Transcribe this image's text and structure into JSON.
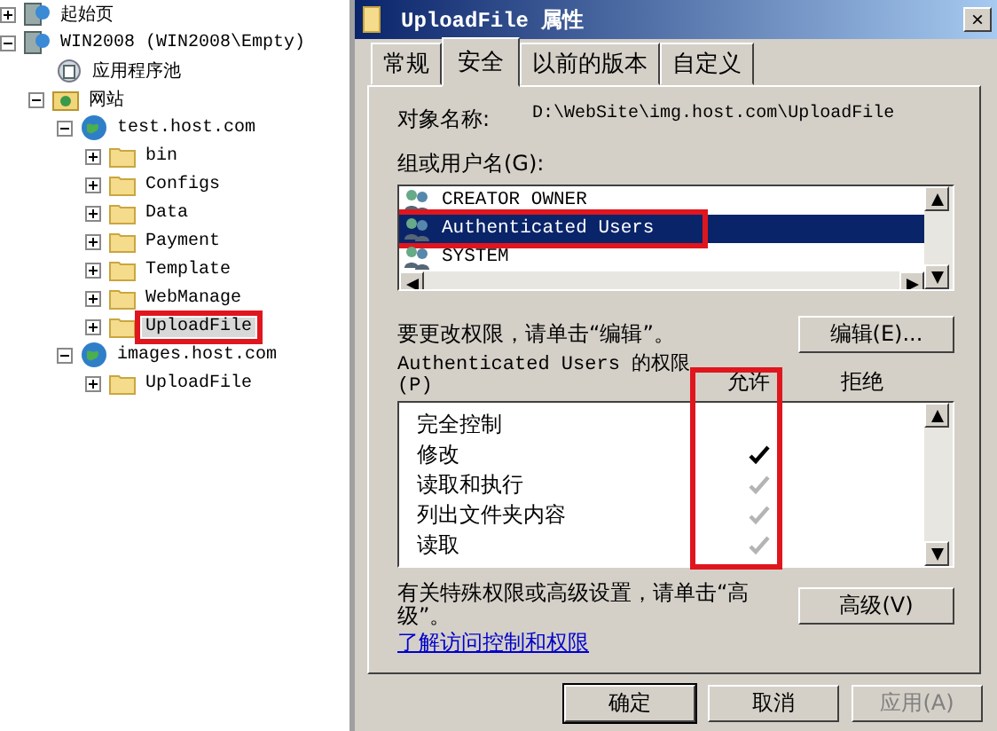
{
  "tree": [
    {
      "label": "起始页",
      "kind": "server",
      "expanded": false,
      "selected": false,
      "highlighted": false
    },
    {
      "label": "WIN2008 (WIN2008\\Empty)",
      "kind": "server",
      "expanded": true,
      "selected": false,
      "highlighted": false,
      "children": [
        {
          "label": "应用程序池",
          "kind": "pool",
          "selected": false,
          "highlighted": false
        },
        {
          "label": "网站",
          "kind": "sites",
          "expanded": true,
          "selected": false,
          "highlighted": false,
          "children": [
            {
              "label": "test.host.com",
              "kind": "globe",
              "expanded": true,
              "selected": false,
              "highlighted": false,
              "children": [
                {
                  "label": "bin",
                  "kind": "folder",
                  "expanded": false,
                  "selected": false,
                  "highlighted": false
                },
                {
                  "label": "Configs",
                  "kind": "folder",
                  "expanded": false,
                  "selected": false,
                  "highlighted": false
                },
                {
                  "label": "Data",
                  "kind": "folder",
                  "expanded": false,
                  "selected": false,
                  "highlighted": false
                },
                {
                  "label": "Payment",
                  "kind": "folder",
                  "expanded": false,
                  "selected": false,
                  "highlighted": false
                },
                {
                  "label": "Template",
                  "kind": "folder",
                  "expanded": false,
                  "selected": false,
                  "highlighted": false
                },
                {
                  "label": "WebManage",
                  "kind": "folder",
                  "expanded": false,
                  "selected": false,
                  "highlighted": false
                },
                {
                  "label": "UploadFile",
                  "kind": "folder",
                  "expanded": false,
                  "selected": true,
                  "highlighted": true
                }
              ]
            },
            {
              "label": "images.host.com",
              "kind": "globe",
              "expanded": true,
              "selected": false,
              "highlighted": false,
              "children": [
                {
                  "label": "UploadFile",
                  "kind": "folder",
                  "expanded": false,
                  "selected": false,
                  "highlighted": false
                }
              ]
            }
          ]
        }
      ]
    }
  ],
  "dialog": {
    "title": "UploadFile 属性",
    "close": "×",
    "tabs": [
      {
        "label": "常规",
        "selected": false
      },
      {
        "label": "安全",
        "selected": true
      },
      {
        "label": "以前的版本",
        "selected": false
      },
      {
        "label": "自定义",
        "selected": false
      }
    ],
    "object_label": "对象名称:",
    "object_value": "D:\\WebSite\\img.host.com\\UploadFile",
    "users_label": "组或用户名(G):",
    "users": [
      {
        "name": "CREATOR OWNER",
        "selected": false,
        "highlighted": false
      },
      {
        "name": "Authenticated Users",
        "selected": true,
        "highlighted": true
      },
      {
        "name": "SYSTEM",
        "selected": false,
        "highlighted": false
      }
    ],
    "edit_hint": "要更改权限，请单击“编辑”。",
    "edit_button": "编辑(E)...",
    "perm_label": "Authenticated Users 的权限(P)",
    "allow_header": "允许",
    "deny_header": "拒绝",
    "allow_highlighted": true,
    "permissions": [
      {
        "name": "完全控制",
        "allow": false
      },
      {
        "name": "修改",
        "allow": true,
        "inherited": false
      },
      {
        "name": "读取和执行",
        "allow": true,
        "inherited": true
      },
      {
        "name": "列出文件夹内容",
        "allow": true,
        "inherited": true
      },
      {
        "name": "读取",
        "allow": true,
        "inherited": true
      }
    ],
    "advanced_hint": "有关特殊权限或高级设置，请单击“高级”。",
    "advanced_button": "高级(V)",
    "link": "了解访问控制和权限",
    "buttons": [
      {
        "label": "确定",
        "disabled": false
      },
      {
        "label": "取消",
        "disabled": false
      },
      {
        "label": "应用(A)",
        "disabled": true
      }
    ]
  }
}
